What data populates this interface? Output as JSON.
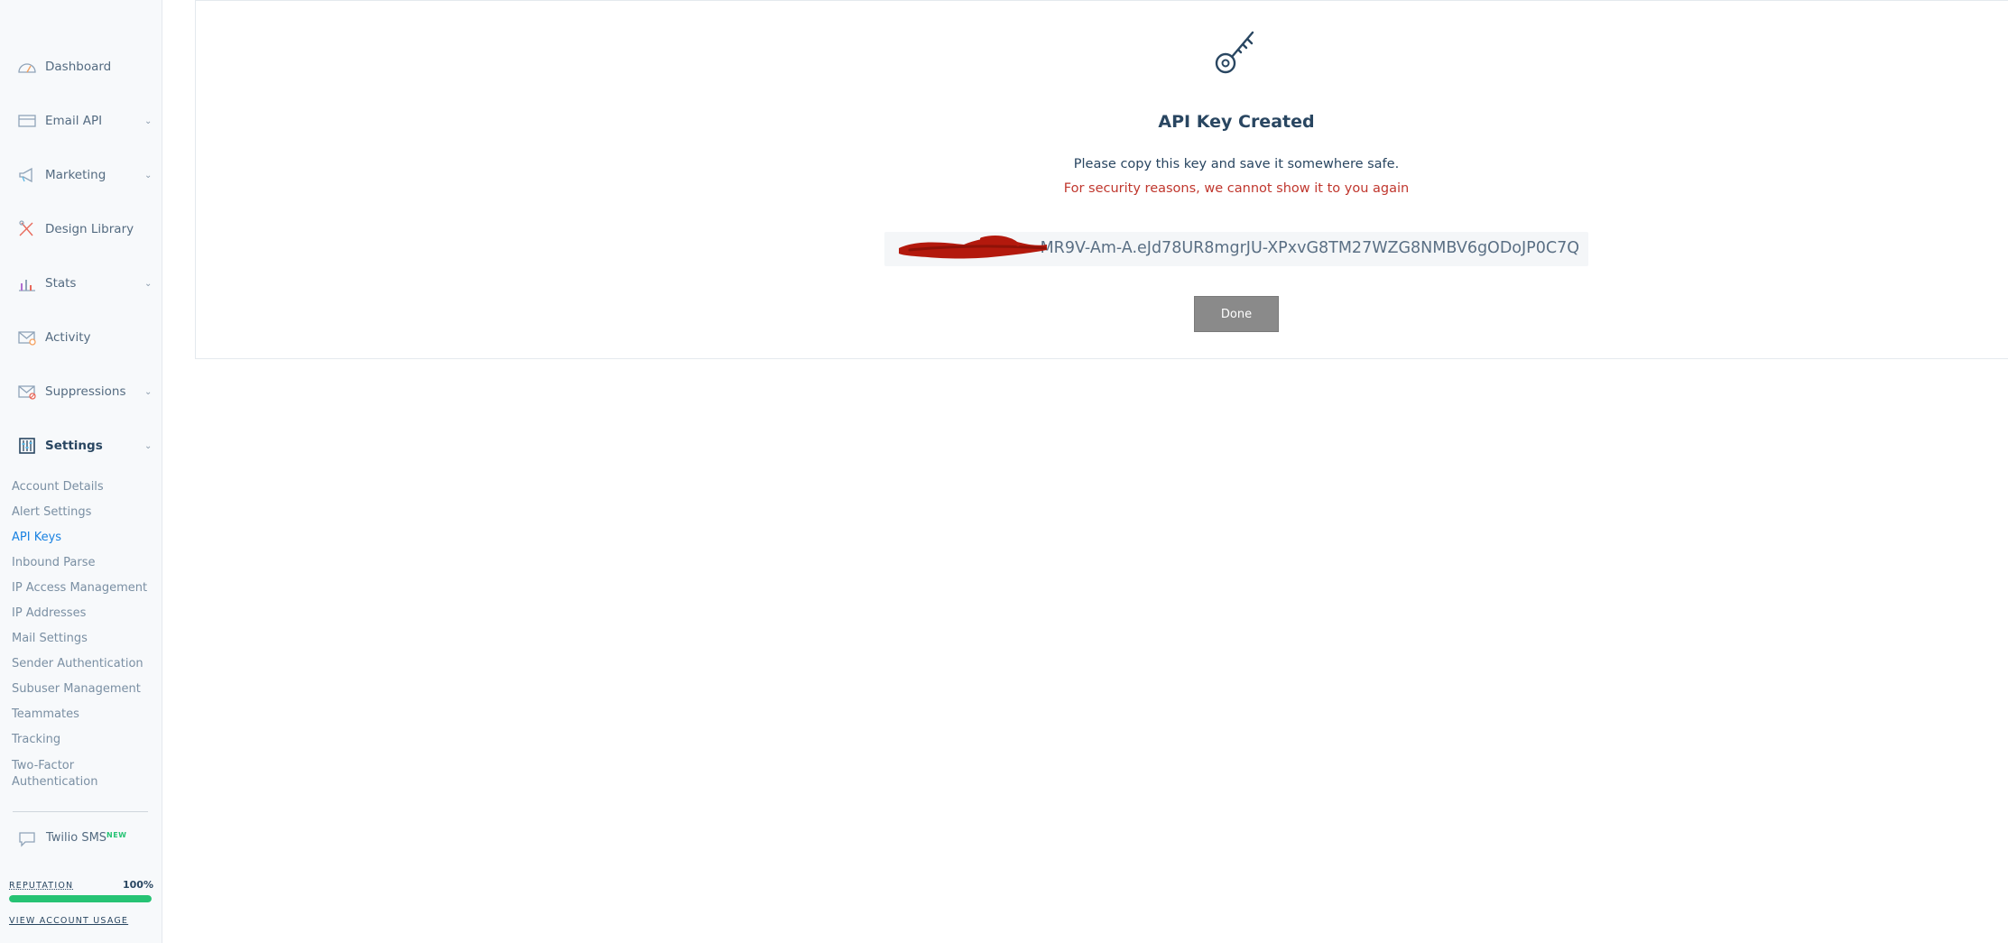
{
  "sidebar": {
    "items": [
      {
        "label": "Dashboard",
        "icon": "dashboard-gauge-icon",
        "chevron": false
      },
      {
        "label": "Email API",
        "icon": "email-api-icon",
        "chevron": true
      },
      {
        "label": "Marketing",
        "icon": "megaphone-icon",
        "chevron": true
      },
      {
        "label": "Design Library",
        "icon": "design-library-icon",
        "chevron": false
      },
      {
        "label": "Stats",
        "icon": "stats-chart-icon",
        "chevron": true
      },
      {
        "label": "Activity",
        "icon": "activity-envelope-icon",
        "chevron": false
      },
      {
        "label": "Suppressions",
        "icon": "suppressions-icon",
        "chevron": true
      },
      {
        "label": "Settings",
        "icon": "settings-sliders-icon",
        "chevron": true
      }
    ],
    "settings_sub": [
      "Account Details",
      "Alert Settings",
      "API Keys",
      "Inbound Parse",
      "IP Access Management",
      "IP Addresses",
      "Mail Settings",
      "Sender Authentication",
      "Subuser Management",
      "Teammates",
      "Tracking",
      "Two-Factor Authentication"
    ],
    "active_sub": "API Keys",
    "twilio": {
      "label": "Twilio SMS",
      "badge": "NEW"
    },
    "reputation": {
      "label": "REPUTATION",
      "value": "100%",
      "fraction": 1.0
    },
    "usage_link": "VIEW ACCOUNT USAGE"
  },
  "main": {
    "title": "API Key Created",
    "message": "Please copy this key and save it somewhere safe.",
    "warning": "For security reasons, we cannot show it to you again",
    "key_visible": "MR9V-Am-A.eJd78UR8mgrJU-XPxvG8TM27WZG8NMBV6gODoJP0C7Q",
    "done_label": "Done"
  },
  "colors": {
    "accent": "#1a82e2",
    "warning": "#c0372e",
    "reputation": "#26c374",
    "redaction": "#b3190d"
  }
}
